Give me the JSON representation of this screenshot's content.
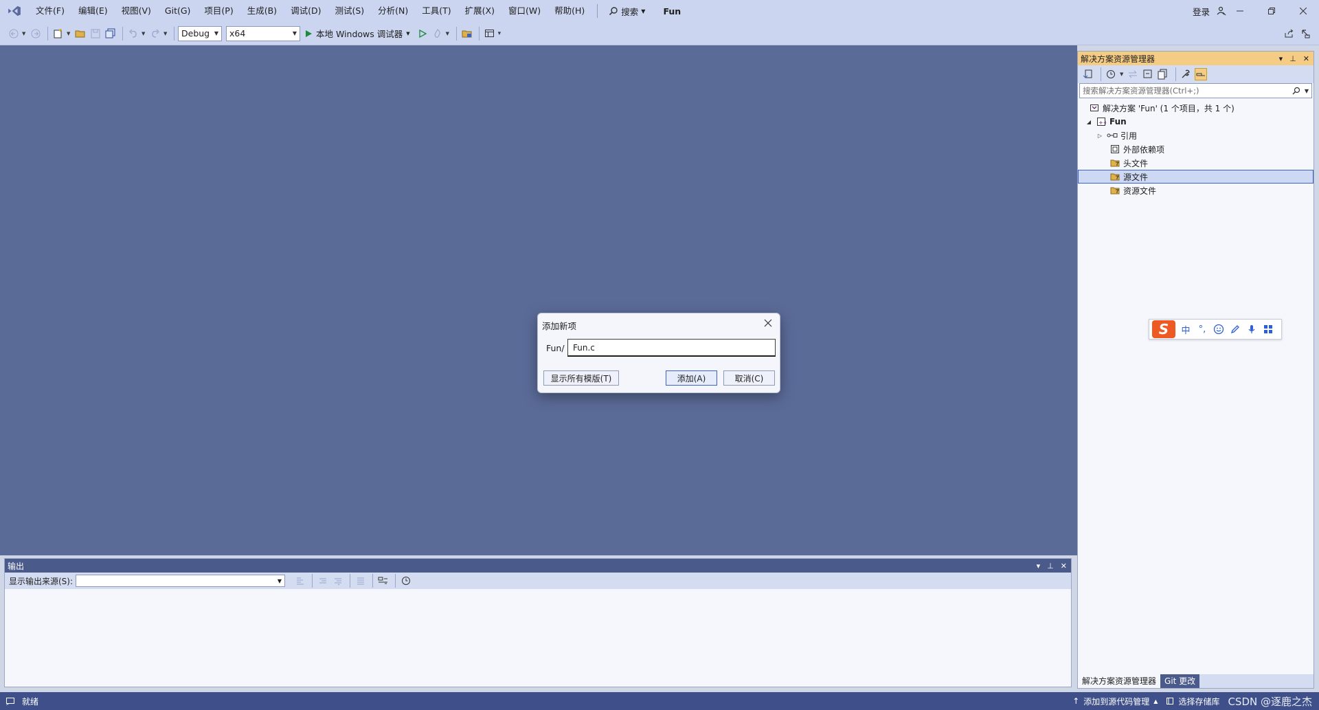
{
  "menubar": {
    "items": [
      "文件(F)",
      "编辑(E)",
      "视图(V)",
      "Git(G)",
      "项目(P)",
      "生成(B)",
      "调试(D)",
      "测试(S)",
      "分析(N)",
      "工具(T)",
      "扩展(X)",
      "窗口(W)",
      "帮助(H)"
    ],
    "search_label": "搜索",
    "solution_name": "Fun",
    "login_label": "登录"
  },
  "toolbar": {
    "config_value": "Debug",
    "platform_value": "x64",
    "run_label": "本地 Windows 调试器"
  },
  "solution_explorer": {
    "title": "解决方案资源管理器",
    "search_placeholder": "搜索解决方案资源管理器(Ctrl+;)",
    "tree": {
      "solution": "解决方案 'Fun' (1 个项目，共 1 个)",
      "project": "Fun",
      "references": "引用",
      "external_deps": "外部依赖项",
      "header_files": "头文件",
      "source_files": "源文件",
      "resource_files": "资源文件"
    },
    "tabs": {
      "explorer": "解决方案资源管理器",
      "git": "Git 更改"
    }
  },
  "output": {
    "title": "输出",
    "source_label": "显示输出来源(S):"
  },
  "dialog": {
    "title": "添加新项",
    "prefix": "Fun/",
    "input_value": "Fun.c",
    "show_templates_label": "显示所有模版(T)",
    "add_label": "添加(A)",
    "cancel_label": "取消(C)"
  },
  "ime": {
    "logo": "S",
    "mode": "中",
    "punct": "°,"
  },
  "statusbar": {
    "status": "就绪",
    "source_control": "添加到源代码管理",
    "repo": "选择存储库",
    "watermark": "CSDN @逐鹿之杰"
  },
  "colors": {
    "menubar_bg": "#ccd5f0",
    "editor_bg": "#5b6b98",
    "statusbar_bg": "#3e4f8a",
    "explorer_header_bg": "#f5cc84",
    "run_green": "#1e8a3c"
  }
}
